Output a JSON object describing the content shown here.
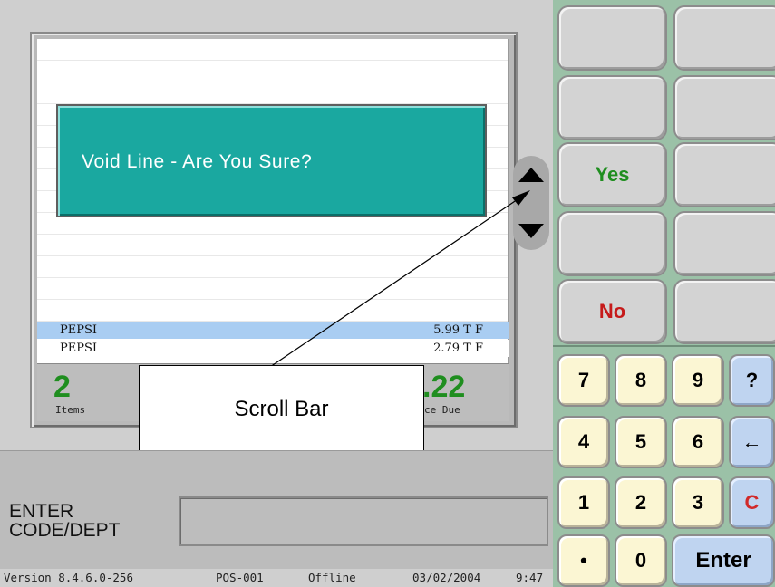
{
  "dialog": {
    "message": "Void Line - Are You Sure?"
  },
  "receipt": {
    "lines": [
      {
        "name": "PEPSI",
        "price": "5.99 T  F",
        "selected": true
      },
      {
        "name": "PEPSI",
        "price": "2.79 T  F",
        "selected": false
      }
    ]
  },
  "totals": {
    "items_count": "2",
    "items_label": "Items",
    "balance_value": ".22",
    "balance_label": "ce Due"
  },
  "callout": {
    "text": "Scroll Bar"
  },
  "entry": {
    "label_line1": "ENTER",
    "label_line2": "CODE/DEPT",
    "value": ""
  },
  "status": {
    "version": "Version  8.4.6.0-256",
    "terminal": "POS-001",
    "mode": "Offline",
    "date": "03/02/2004",
    "time": "9:47"
  },
  "function_keys": {
    "yes": "Yes",
    "no": "No"
  },
  "numpad": {
    "row1": [
      "7",
      "8",
      "9",
      "?"
    ],
    "row2": [
      "4",
      "5",
      "6",
      "←"
    ],
    "row3": [
      "1",
      "2",
      "3",
      "C"
    ],
    "row4": [
      "•",
      "0",
      "Enter"
    ]
  },
  "colors": {
    "dialog_bg": "#1aa8a0",
    "yes_text": "#1f8e1f",
    "no_text": "#c61a1a",
    "clear_text": "#d12a2a",
    "selected_row": "#a9cdf2",
    "keypad_bg": "#9bc1a7"
  },
  "icons": {
    "scroll_up": "triangle-up-icon",
    "scroll_down": "triangle-down-icon",
    "backspace": "left-arrow-icon"
  }
}
